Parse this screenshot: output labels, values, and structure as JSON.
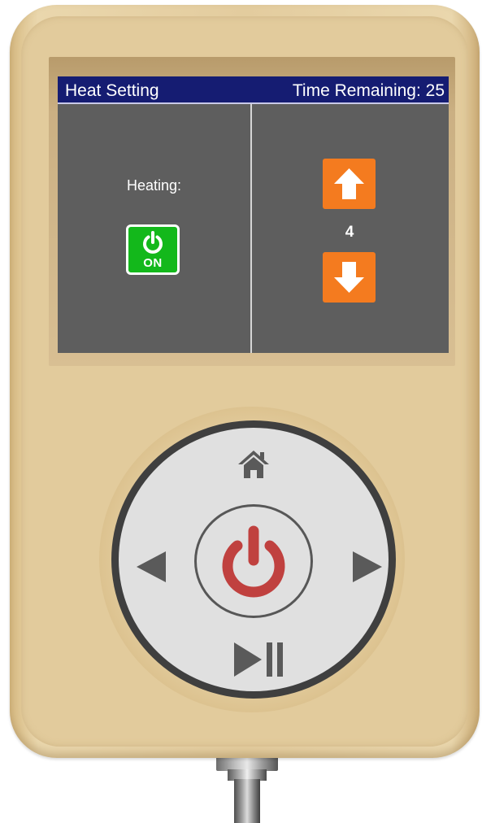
{
  "screen": {
    "title": "Heat Setting",
    "time_remaining": "Time Remaining: 25",
    "heating_label": "Heating:",
    "heating_button": {
      "label": "ON",
      "icon": "power-icon",
      "color": "#13b81b"
    },
    "level": {
      "value": "4",
      "up_icon": "arrow-up-icon",
      "down_icon": "arrow-down-icon",
      "color": "#f47b1f"
    }
  },
  "controls": {
    "home_icon": "home-icon",
    "left_icon": "triangle-left-icon",
    "right_icon": "triangle-right-icon",
    "power_icon": "power-icon",
    "power_color": "#c0413f",
    "play_pause_icon": "play-pause-icon"
  },
  "colors": {
    "title_bar": "#151c72",
    "screen_bg": "#5e5e5e",
    "device_body": "#e2cb9c"
  }
}
